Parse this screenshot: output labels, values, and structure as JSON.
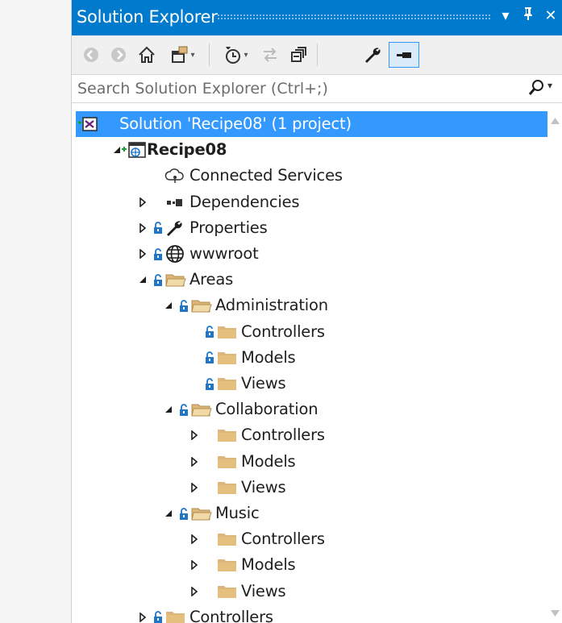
{
  "window": {
    "title": "Solution Explorer",
    "controls": [
      {
        "name": "window-menu-dropdown",
        "glyph": "▾"
      },
      {
        "name": "pin",
        "glyph": "⊥"
      },
      {
        "name": "close",
        "glyph": "✕"
      }
    ]
  },
  "search": {
    "placeholder": "Search Solution Explorer (Ctrl+;)"
  },
  "tree": [
    {
      "label": "Solution 'Recipe08' (1 project)",
      "depth": 0,
      "expander": "none",
      "icon": "solution-icon",
      "lock": false,
      "selected": true,
      "bold": false
    },
    {
      "label": "Recipe08",
      "depth": 1,
      "expander": "expanded",
      "icon": "web-project-icon",
      "lock": false,
      "selected": false,
      "bold": true
    },
    {
      "label": "Connected Services",
      "depth": 2,
      "expander": "none",
      "icon": "connected-services-icon",
      "lock": false,
      "selected": false,
      "bold": false
    },
    {
      "label": "Dependencies",
      "depth": 2,
      "expander": "collapsed",
      "icon": "dependencies-icon",
      "lock": false,
      "selected": false,
      "bold": false
    },
    {
      "label": "Properties",
      "depth": 2,
      "expander": "collapsed",
      "icon": "wrench-icon",
      "lock": true,
      "selected": false,
      "bold": false
    },
    {
      "label": "wwwroot",
      "depth": 2,
      "expander": "collapsed",
      "icon": "globe-icon",
      "lock": true,
      "selected": false,
      "bold": false
    },
    {
      "label": "Areas",
      "depth": 2,
      "expander": "expanded",
      "icon": "folder-open-icon",
      "lock": true,
      "selected": false,
      "bold": false
    },
    {
      "label": "Administration",
      "depth": 3,
      "expander": "expanded",
      "icon": "folder-open-icon",
      "lock": true,
      "selected": false,
      "bold": false
    },
    {
      "label": "Controllers",
      "depth": 4,
      "expander": "none",
      "icon": "folder-icon",
      "lock": true,
      "selected": false,
      "bold": false
    },
    {
      "label": "Models",
      "depth": 4,
      "expander": "none",
      "icon": "folder-icon",
      "lock": true,
      "selected": false,
      "bold": false
    },
    {
      "label": "Views",
      "depth": 4,
      "expander": "none",
      "icon": "folder-icon",
      "lock": true,
      "selected": false,
      "bold": false
    },
    {
      "label": "Collaboration",
      "depth": 3,
      "expander": "expanded",
      "icon": "folder-open-icon",
      "lock": true,
      "selected": false,
      "bold": false
    },
    {
      "label": "Controllers",
      "depth": 4,
      "expander": "collapsed",
      "icon": "folder-icon",
      "lock": false,
      "selected": false,
      "bold": false
    },
    {
      "label": "Models",
      "depth": 4,
      "expander": "collapsed",
      "icon": "folder-icon",
      "lock": false,
      "selected": false,
      "bold": false
    },
    {
      "label": "Views",
      "depth": 4,
      "expander": "collapsed",
      "icon": "folder-icon",
      "lock": false,
      "selected": false,
      "bold": false
    },
    {
      "label": "Music",
      "depth": 3,
      "expander": "expanded",
      "icon": "folder-open-icon",
      "lock": true,
      "selected": false,
      "bold": false
    },
    {
      "label": "Controllers",
      "depth": 4,
      "expander": "collapsed",
      "icon": "folder-icon",
      "lock": false,
      "selected": false,
      "bold": false
    },
    {
      "label": "Models",
      "depth": 4,
      "expander": "collapsed",
      "icon": "folder-icon",
      "lock": false,
      "selected": false,
      "bold": false
    },
    {
      "label": "Views",
      "depth": 4,
      "expander": "collapsed",
      "icon": "folder-icon",
      "lock": false,
      "selected": false,
      "bold": false
    },
    {
      "label": "Controllers",
      "depth": 2,
      "expander": "collapsed",
      "icon": "folder-icon",
      "lock": true,
      "selected": false,
      "bold": false
    }
  ],
  "colors": {
    "accent": "#007acc",
    "selection": "#3399ff",
    "folder": "#dcb67a",
    "lock": "#1f75c8",
    "add_badge": "#1a9e35"
  }
}
